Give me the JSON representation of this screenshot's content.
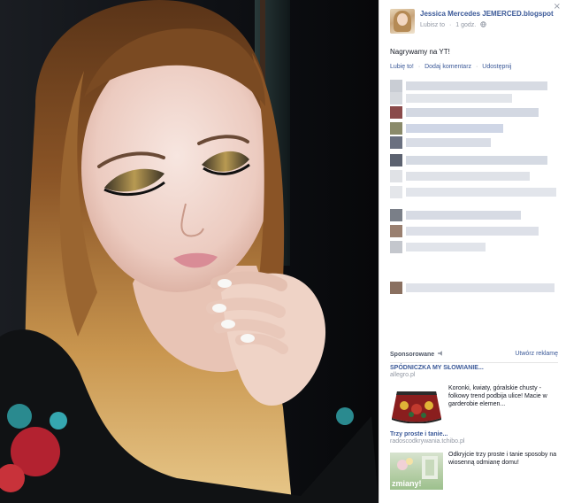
{
  "photo": {
    "alt": ""
  },
  "panel": {
    "close_glyph": "×",
    "author": "Jessica Mercedes JEMERCED.blogspot",
    "meta": {
      "like_page": "Lubisz to",
      "separator": "·",
      "time": "1 godz.",
      "audience_icon": "globe-icon"
    },
    "post_text": "Nagrywamy na YT!",
    "actions": {
      "like": "Lubię to!",
      "comment": "Dodaj komentarz",
      "share": "Udostępnij",
      "separator": "·"
    }
  },
  "sponsored": {
    "label": "Sponsorowane",
    "create_ad": "Utwórz reklamę",
    "ads": [
      {
        "title": "SPÓDNICZKA MY SŁOWIANIE...",
        "domain": "allegro.pl",
        "description": "Koronki, kwiaty, góralskie chusty - folkowy trend podbija ulice! Macie w garderobie elemen..."
      },
      {
        "title": "Trzy proste i tanie...",
        "domain": "radoscodkrywania.tchibo.pl",
        "description": "Odkryjcie trzy proste i tanie sposoby na wiosenną odmianę domu!",
        "image_text": "zmiany!"
      }
    ]
  },
  "colors": {
    "link": "#3b5998",
    "muted": "#9197a3",
    "text": "#141823"
  }
}
